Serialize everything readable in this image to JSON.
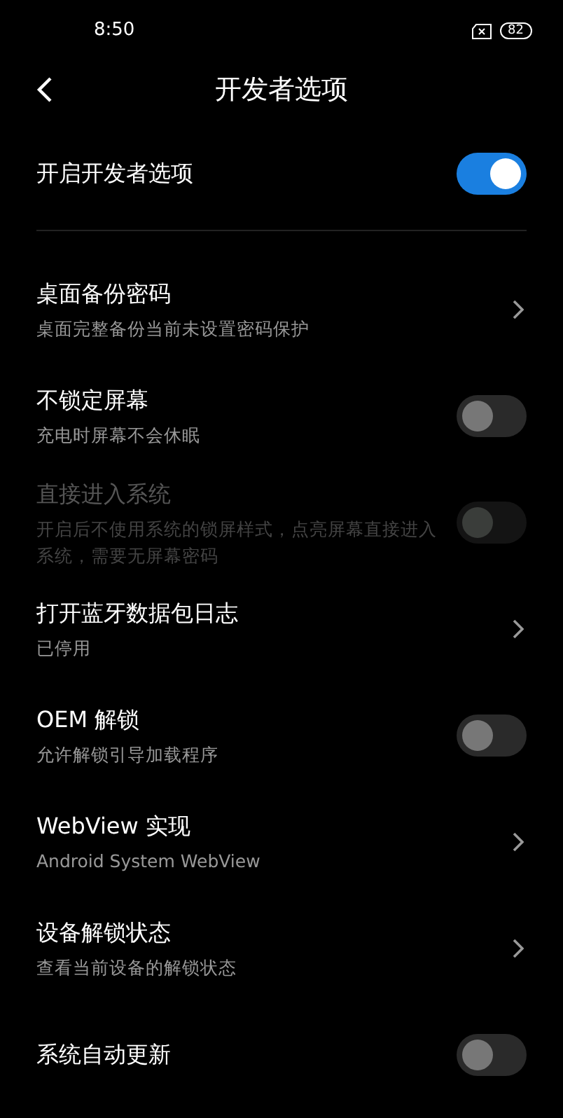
{
  "status_bar": {
    "time": "8:50",
    "battery": "82"
  },
  "header": {
    "title": "开发者选项"
  },
  "master": {
    "label": "开启开发者选项",
    "on": true
  },
  "items": [
    {
      "kind": "link",
      "title": "桌面备份密码",
      "subtitle": "桌面完整备份当前未设置密码保护",
      "disabled": false
    },
    {
      "kind": "toggle",
      "title": "不锁定屏幕",
      "subtitle": "充电时屏幕不会休眠",
      "on": false,
      "disabled": false
    },
    {
      "kind": "toggle",
      "title": "直接进入系统",
      "subtitle": "开启后不使用系统的锁屏样式，点亮屏幕直接进入系统，需要无屏幕密码",
      "on": false,
      "disabled": true
    },
    {
      "kind": "link",
      "title": "打开蓝牙数据包日志",
      "subtitle": "已停用",
      "disabled": false
    },
    {
      "kind": "toggle",
      "title": "OEM 解锁",
      "subtitle": "允许解锁引导加载程序",
      "on": false,
      "disabled": false
    },
    {
      "kind": "link",
      "title": "WebView 实现",
      "subtitle": "Android System WebView",
      "disabled": false
    },
    {
      "kind": "link",
      "title": "设备解锁状态",
      "subtitle": "查看当前设备的解锁状态",
      "disabled": false
    },
    {
      "kind": "toggle",
      "title": "系统自动更新",
      "on": false,
      "disabled": false
    }
  ]
}
